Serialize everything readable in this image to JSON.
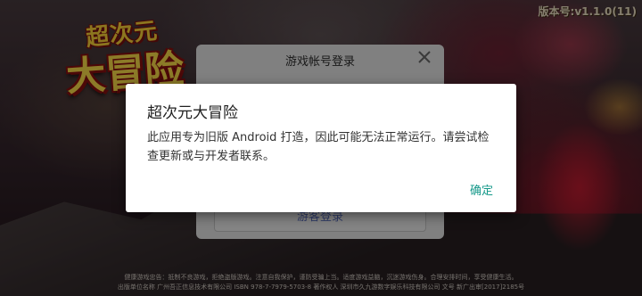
{
  "game": {
    "logo_top": "超次元",
    "logo_main": "大冒险",
    "version": "版本号:v1.1.0(11)"
  },
  "login_dialog": {
    "title": "游戏帐号登录",
    "close_icon": "close-icon",
    "guest_button": "游客登录"
  },
  "alert": {
    "title": "超次元大冒险",
    "message": "此应用专为旧版 Android 打造，因此可能无法正常运行。请尝试检查更新或与开发者联系。",
    "ok_button": "确定"
  },
  "footer": {
    "line1": "健康游戏忠告：抵制不良游戏，拒绝盗版游戏。注意自我保护，谨防受骗上当。适度游戏益脑，沉迷游戏伤身。合理安排时间，享受健康生活。",
    "line2": "出版单位名称 广州吾正信息技术有限公司 ISBN 978-7-7979-5703-8 著作权人 深圳市久九游数字娱乐科技有限公司 文号 新广出审[2017]2185号"
  },
  "colors": {
    "accent": "#16998a",
    "guest_link": "#5a6fc0",
    "logo_yellow": "#ffe14a",
    "logo_outline": "#8a0f0f"
  }
}
